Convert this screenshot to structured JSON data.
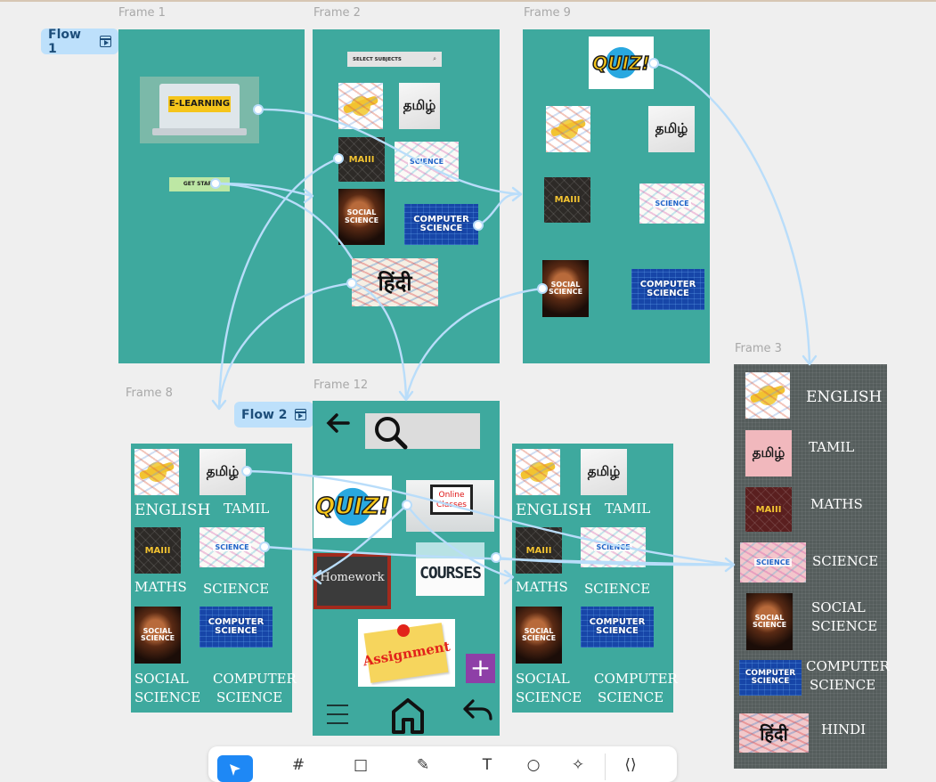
{
  "frames": {
    "frame1": "Frame 1",
    "frame2": "Frame 2",
    "frame9": "Frame 9",
    "frame3": "Frame 3",
    "frame8": "Frame 8",
    "frame12": "Frame 12"
  },
  "flows": {
    "flow1": "Flow 1",
    "flow2": "Flow 2"
  },
  "frame1": {
    "banner_text": "E-LEARNING",
    "get_start": "GET START"
  },
  "frame2": {
    "select_subjects": "SELECT SUBJECTS"
  },
  "tiles": {
    "tamil_glyph": "தமிழ்",
    "maths_glyph": "MAIII",
    "science_glyph": "SCIENCE",
    "social_glyph_1": "SOCIAL",
    "social_glyph_2": "SCIENCE",
    "cs_glyph_1": "COMPUTER",
    "cs_glyph_2": "SCIENCE",
    "hindi_glyph": "हिंदी",
    "quiz_glyph": "QUIZ!",
    "online_1": "Online",
    "online_2": "Classes",
    "homework": "Homework",
    "courses": "COURSES",
    "assignment": "Assignment"
  },
  "subject_labels": {
    "english": "ENGLISH",
    "tamil": "TAMIL",
    "maths": "MATHS",
    "science": "SCIENCE",
    "social_1": "SOCIAL",
    "social_2": "SCIENCE",
    "cs_1": "COMPUTER",
    "cs_2": "SCIENCE"
  },
  "frame3_labels": {
    "english": "ENGLISH",
    "tamil": "TAMIL",
    "maths": "MATHS",
    "science": "SCIENCE",
    "social_1": "SOCIAL",
    "social_2": "SCIENCE",
    "cs_1": "COMPUTER",
    "cs_2": "SCIENCE",
    "hindi": "HINDI"
  },
  "frame12": {
    "plus": "+"
  },
  "colors": {
    "frame_teal": "#3ea99e",
    "frame3_bg": "#555d5c",
    "flow_chip": "#bde0fb",
    "connector": "#b9ddfa",
    "toolbar_active": "#1e88f5"
  },
  "toolbar": {
    "icons": [
      "move-tool-icon",
      "frame-tool-icon",
      "rectangle-tool-icon",
      "pen-tool-icon",
      "text-tool-icon",
      "comment-tool-icon",
      "actions-tool-icon",
      "dev-mode-icon"
    ]
  }
}
